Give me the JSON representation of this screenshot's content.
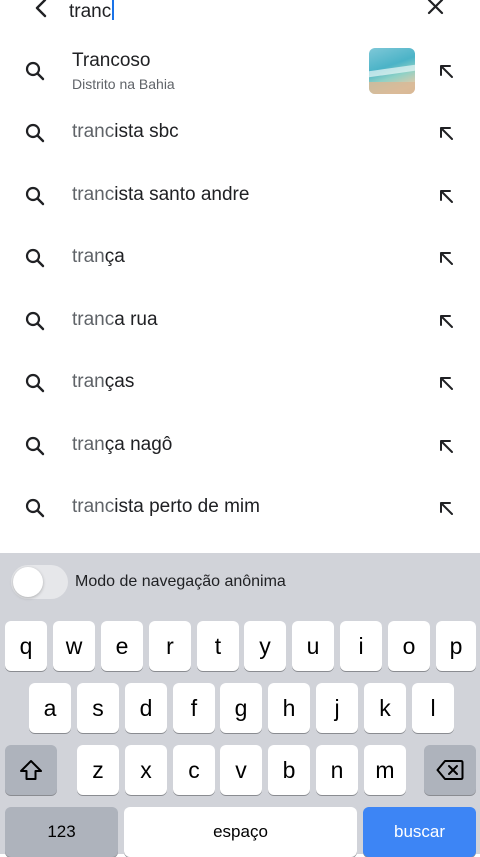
{
  "search": {
    "query": "tranc"
  },
  "suggestions": [
    {
      "typed": "",
      "rest": "Trancoso",
      "subtitle": "Distrito na Bahia"
    },
    {
      "typed": "tranc",
      "rest": "ista sbc"
    },
    {
      "typed": "tranc",
      "rest": "ista santo andre"
    },
    {
      "typed": "tran",
      "rest": "ça"
    },
    {
      "typed": "tranc",
      "rest": "a rua"
    },
    {
      "typed": "tran",
      "rest": "ças"
    },
    {
      "typed": "tran",
      "rest": "ça nagô"
    },
    {
      "typed": "tranc",
      "rest": "ista perto de mim"
    }
  ],
  "keyboard": {
    "incognito_label": "Modo de navegação anônima",
    "incognito_on": false,
    "row1": [
      "q",
      "w",
      "e",
      "r",
      "t",
      "y",
      "u",
      "i",
      "o",
      "p"
    ],
    "row2": [
      "a",
      "s",
      "d",
      "f",
      "g",
      "h",
      "j",
      "k",
      "l"
    ],
    "row3": [
      "z",
      "x",
      "c",
      "v",
      "b",
      "n",
      "m"
    ],
    "numbers_label": "123",
    "space_label": "espaço",
    "search_label": "buscar"
  },
  "colors": {
    "accent": "#1a73e8",
    "search_key": "#3d85f5",
    "keyboard_bg": "#d1d3d9"
  }
}
